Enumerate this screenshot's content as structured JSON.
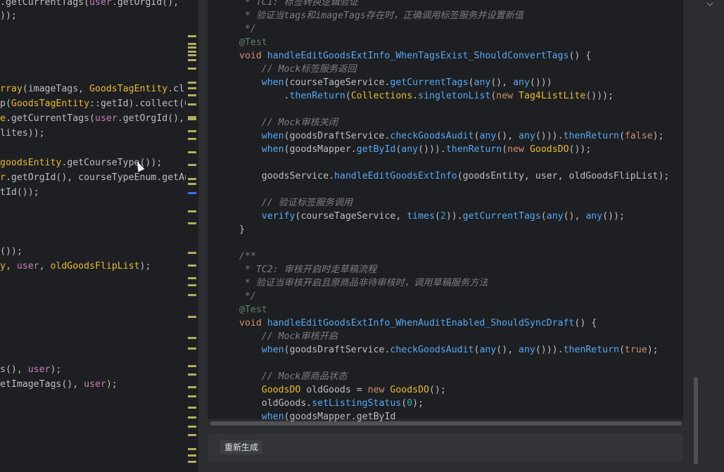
{
  "left_editor": {
    "lines": [
      [
        {
          "t": ".getCurrentTags(",
          "c": "t"
        },
        {
          "t": "user",
          "c": "p"
        },
        {
          "t": ".getOrgId(),",
          "c": "t"
        }
      ],
      [
        {
          "t": "));",
          "c": "t"
        }
      ],
      [
        {
          "t": "rray",
          "c": "y"
        },
        {
          "t": "(imageTags, ",
          "c": "t"
        },
        {
          "t": "GoodsTagEntity",
          "c": "y"
        },
        {
          "t": ".cl",
          "c": "t"
        }
      ],
      [
        {
          "t": "p(",
          "c": "t"
        },
        {
          "t": "GoodsTagEntity",
          "c": "y"
        },
        {
          "t": "::getId).collect(C",
          "c": "t"
        }
      ],
      [
        {
          "t": "e",
          "c": "y"
        },
        {
          "t": ".getCurrentTags(",
          "c": "t"
        },
        {
          "t": "user",
          "c": "p"
        },
        {
          "t": ".getOrgId(),",
          "c": "t"
        }
      ],
      [
        {
          "t": "lites));",
          "c": "t"
        }
      ],
      [
        {
          "t": "goodsEntity",
          "c": "y"
        },
        {
          "t": ".getCourseType());",
          "c": "t"
        }
      ],
      [
        {
          "t": "r",
          "c": "y"
        },
        {
          "t": ".getOrgId(), courseTypeEnum.getAu",
          "c": "t"
        }
      ],
      [
        {
          "t": "tId());",
          "c": "t"
        }
      ],
      [
        {
          "t": "());",
          "c": "t"
        }
      ],
      [
        {
          "t": "y, ",
          "c": "y"
        },
        {
          "t": "user",
          "c": "p"
        },
        {
          "t": ", ",
          "c": "t"
        },
        {
          "t": "oldGoodsFlipList",
          "c": "y"
        },
        {
          "t": ");",
          "c": "t"
        }
      ],
      [
        {
          "t": "s(), ",
          "c": "t"
        },
        {
          "t": "user",
          "c": "p"
        },
        {
          "t": ");",
          "c": "t"
        }
      ],
      [
        {
          "t": "etImageTags(), ",
          "c": "t"
        },
        {
          "t": "user",
          "c": "p"
        },
        {
          "t": ");",
          "c": "t"
        }
      ]
    ]
  },
  "code_block": {
    "lines": [
      [
        {
          "t": " * TC1: 标签转换逻辑验证",
          "c": "c"
        }
      ],
      [
        {
          "t": " * 验证当tags和imageTags存在时，正确调用标签服务并设置新值",
          "c": "c"
        }
      ],
      [
        {
          "t": " */",
          "c": "c"
        }
      ],
      [
        {
          "t": "@Test",
          "c": "a"
        }
      ],
      [
        {
          "t": "void ",
          "c": "k"
        },
        {
          "t": "handleEditGoodsExtInfo_WhenTagsExist_ShouldConvertTags",
          "c": "m"
        },
        {
          "t": "() {",
          "c": "t"
        }
      ],
      [
        {
          "t": "    // Mock标签服务返回",
          "c": "c"
        }
      ],
      [
        {
          "t": "    when",
          "c": "m"
        },
        {
          "t": "(courseTageService.",
          "c": "t"
        },
        {
          "t": "getCurrentTags",
          "c": "m"
        },
        {
          "t": "(",
          "c": "t"
        },
        {
          "t": "any",
          "c": "m"
        },
        {
          "t": "(), ",
          "c": "t"
        },
        {
          "t": "any",
          "c": "m"
        },
        {
          "t": "()))",
          "c": "t"
        }
      ],
      [
        {
          "t": "        .",
          "c": "t"
        },
        {
          "t": "thenReturn",
          "c": "m"
        },
        {
          "t": "(",
          "c": "t"
        },
        {
          "t": "Collections",
          "c": "y"
        },
        {
          "t": ".",
          "c": "t"
        },
        {
          "t": "singletonList",
          "c": "m"
        },
        {
          "t": "(",
          "c": "t"
        },
        {
          "t": "new ",
          "c": "k"
        },
        {
          "t": "Tag4ListLite",
          "c": "y"
        },
        {
          "t": "()));",
          "c": "t"
        }
      ],
      [],
      [
        {
          "t": "    // Mock审核关闭",
          "c": "c"
        }
      ],
      [
        {
          "t": "    when",
          "c": "m"
        },
        {
          "t": "(goodsDraftService.",
          "c": "t"
        },
        {
          "t": "checkGoodsAudit",
          "c": "m"
        },
        {
          "t": "(",
          "c": "t"
        },
        {
          "t": "any",
          "c": "m"
        },
        {
          "t": "(), ",
          "c": "t"
        },
        {
          "t": "any",
          "c": "m"
        },
        {
          "t": "())).",
          "c": "t"
        },
        {
          "t": "thenReturn",
          "c": "m"
        },
        {
          "t": "(",
          "c": "t"
        },
        {
          "t": "false",
          "c": "k"
        },
        {
          "t": ");",
          "c": "t"
        }
      ],
      [
        {
          "t": "    when",
          "c": "m"
        },
        {
          "t": "(goodsMapper.",
          "c": "t"
        },
        {
          "t": "getById",
          "c": "m"
        },
        {
          "t": "(",
          "c": "t"
        },
        {
          "t": "any",
          "c": "m"
        },
        {
          "t": "())).",
          "c": "t"
        },
        {
          "t": "thenReturn",
          "c": "m"
        },
        {
          "t": "(",
          "c": "t"
        },
        {
          "t": "new ",
          "c": "k"
        },
        {
          "t": "GoodsDO",
          "c": "y"
        },
        {
          "t": "());",
          "c": "t"
        }
      ],
      [],
      [
        {
          "t": "    goodsService.",
          "c": "t"
        },
        {
          "t": "handleEditGoodsExtInfo",
          "c": "m"
        },
        {
          "t": "(goodsEntity, user, oldGoodsFlipList);",
          "c": "t"
        }
      ],
      [],
      [
        {
          "t": "    // 验证标签服务调用",
          "c": "c"
        }
      ],
      [
        {
          "t": "    verify",
          "c": "m"
        },
        {
          "t": "(courseTageService, ",
          "c": "t"
        },
        {
          "t": "times",
          "c": "m"
        },
        {
          "t": "(",
          "c": "t"
        },
        {
          "t": "2",
          "c": "n"
        },
        {
          "t": ")).",
          "c": "t"
        },
        {
          "t": "getCurrentTags",
          "c": "m"
        },
        {
          "t": "(",
          "c": "t"
        },
        {
          "t": "any",
          "c": "m"
        },
        {
          "t": "(), ",
          "c": "t"
        },
        {
          "t": "any",
          "c": "m"
        },
        {
          "t": "());",
          "c": "t"
        }
      ],
      [
        {
          "t": "}",
          "c": "t"
        }
      ],
      [],
      [
        {
          "t": "/**",
          "c": "c"
        }
      ],
      [
        {
          "t": " * TC2: 审核开启时走草稿流程",
          "c": "c"
        }
      ],
      [
        {
          "t": " * 验证当审核开启且原商品非待审核时，调用草稿服务方法",
          "c": "c"
        }
      ],
      [
        {
          "t": " */",
          "c": "c"
        }
      ],
      [
        {
          "t": "@Test",
          "c": "a"
        }
      ],
      [
        {
          "t": "void ",
          "c": "k"
        },
        {
          "t": "handleEditGoodsExtInfo_WhenAuditEnabled_ShouldSyncDraft",
          "c": "m"
        },
        {
          "t": "() {",
          "c": "t"
        }
      ],
      [
        {
          "t": "    // Mock审核开启",
          "c": "c"
        }
      ],
      [
        {
          "t": "    when",
          "c": "m"
        },
        {
          "t": "(goodsDraftService.",
          "c": "t"
        },
        {
          "t": "checkGoodsAudit",
          "c": "m"
        },
        {
          "t": "(",
          "c": "t"
        },
        {
          "t": "any",
          "c": "m"
        },
        {
          "t": "(), ",
          "c": "t"
        },
        {
          "t": "any",
          "c": "m"
        },
        {
          "t": "())).",
          "c": "t"
        },
        {
          "t": "thenReturn",
          "c": "m"
        },
        {
          "t": "(",
          "c": "t"
        },
        {
          "t": "true",
          "c": "k"
        },
        {
          "t": ");",
          "c": "t"
        }
      ],
      [],
      [
        {
          "t": "    // Mock原商品状态",
          "c": "c"
        }
      ],
      [
        {
          "t": "    GoodsDO ",
          "c": "y"
        },
        {
          "t": "oldGoods = ",
          "c": "t"
        },
        {
          "t": "new ",
          "c": "k"
        },
        {
          "t": "GoodsDO",
          "c": "y"
        },
        {
          "t": "();",
          "c": "t"
        }
      ],
      [
        {
          "t": "    oldGoods.",
          "c": "t"
        },
        {
          "t": "setListingStatus",
          "c": "m"
        },
        {
          "t": "(",
          "c": "t"
        },
        {
          "t": "0",
          "c": "n"
        },
        {
          "t": ");",
          "c": "t"
        }
      ],
      [
        {
          "t": "    when",
          "c": "m"
        },
        {
          "t": "(goodsMapper.getById",
          "c": "t"
        }
      ]
    ]
  },
  "regenerate_label": "重新生成",
  "colors": {
    "keyword": "#cf8e6d",
    "method": "#56a8f5",
    "class": "#e8ba36",
    "param": "#c77dbb",
    "comment": "#7a7e85",
    "annotation": "#5f826b",
    "number": "#2aacb8"
  }
}
